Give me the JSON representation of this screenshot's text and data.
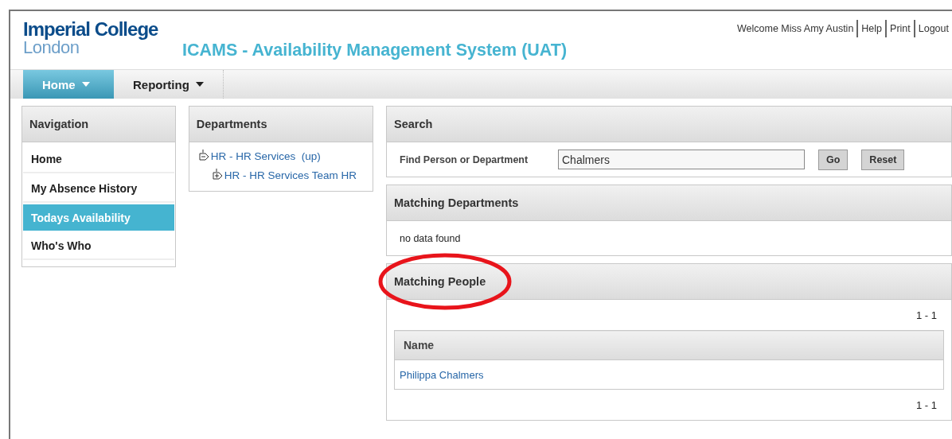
{
  "header": {
    "logo_line1": "Imperial College",
    "logo_line2": "London",
    "title": "ICAMS - Availability Management System (UAT)",
    "user_links": [
      {
        "label": "Welcome Miss Amy Austin",
        "kind": "text"
      },
      {
        "label": "Help",
        "kind": "link"
      },
      {
        "label": "Print",
        "kind": "link"
      },
      {
        "label": "Logout",
        "kind": "link"
      }
    ]
  },
  "menu": [
    {
      "label": "Home",
      "selected": true
    },
    {
      "label": "Reporting",
      "selected": false
    }
  ],
  "navigation": {
    "title": "Navigation",
    "items": [
      {
        "label": "Home",
        "selected": false
      },
      {
        "label": "My Absence History",
        "selected": false
      },
      {
        "label": "Todays Availability",
        "selected": true
      },
      {
        "label": "Who's Who",
        "selected": false
      }
    ]
  },
  "departments": {
    "title": "Departments",
    "tree": [
      {
        "label": "HR - HR Services  (up)",
        "expanded": true,
        "children": [
          {
            "label": "HR - HR Services Team HR",
            "expanded": false
          }
        ]
      }
    ]
  },
  "search": {
    "title": "Search",
    "label": "Find Person or Department",
    "value": "Chalmers",
    "buttons": [
      "Go",
      "Reset"
    ]
  },
  "matching_departments": {
    "title": "Matching Departments",
    "message": "no data found"
  },
  "matching_people": {
    "title": "Matching People",
    "annotated": true,
    "pager_top": "1 - 1",
    "columns": [
      "Name"
    ],
    "rows": [
      [
        "Philippa Chalmers"
      ]
    ],
    "pager_bottom": "1 - 1"
  }
}
